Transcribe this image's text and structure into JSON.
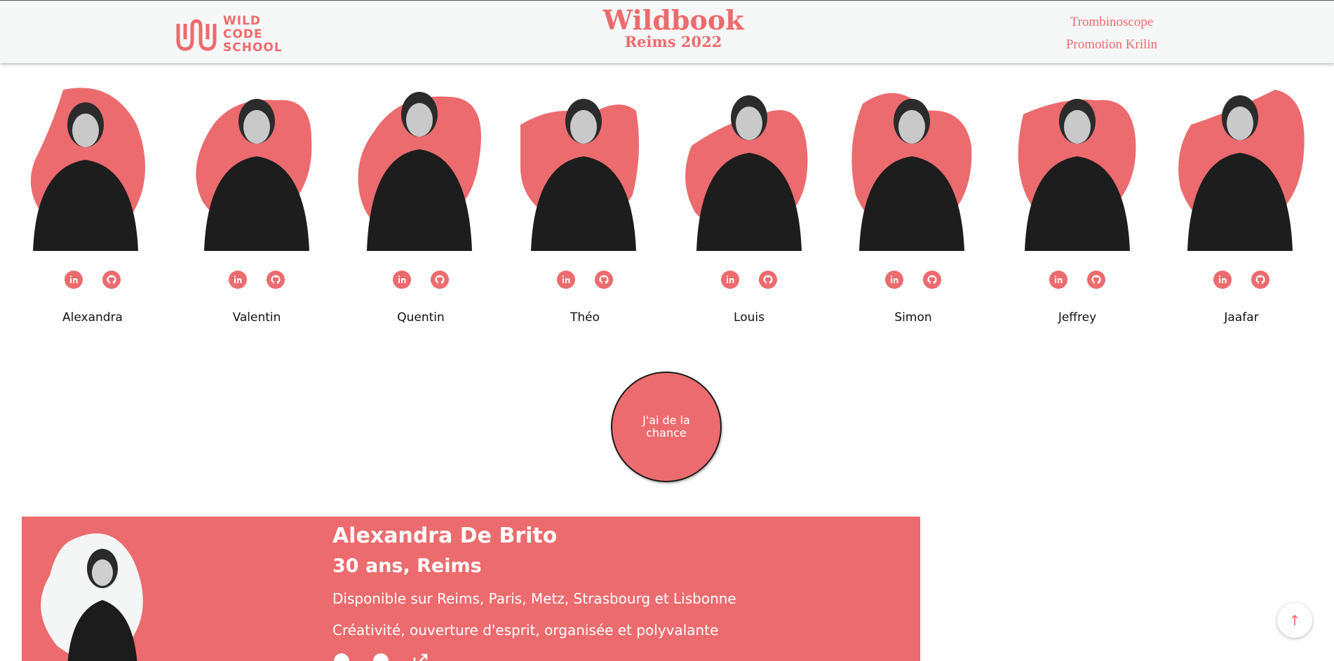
{
  "header": {
    "logo_lines": [
      "WILD",
      "CODE",
      "SCHOOL"
    ],
    "title": "Wildbook",
    "subtitle": "Reims 2022",
    "nav": [
      "Trombinoscope",
      "Promotion Krilin"
    ]
  },
  "students": [
    {
      "name": "Alexandra"
    },
    {
      "name": "Valentin"
    },
    {
      "name": "Quentin"
    },
    {
      "name": "Théo"
    },
    {
      "name": "Louis"
    },
    {
      "name": "Simon"
    },
    {
      "name": "Jeffrey"
    },
    {
      "name": "Jaafar"
    }
  ],
  "luck_button": "J'ai de la chance",
  "card": {
    "name": "Alexandra De Brito",
    "age_city": "30 ans, Reims",
    "availability": "Disponible sur Reims, Paris, Metz, Strasbourg et Lisbonne",
    "qualities": "Créativité, ouverture d'esprit, organisée et polyvalante"
  },
  "scroll_top": "↑",
  "colors": {
    "accent": "#ec6b6e",
    "photo_dark": "#222222"
  }
}
